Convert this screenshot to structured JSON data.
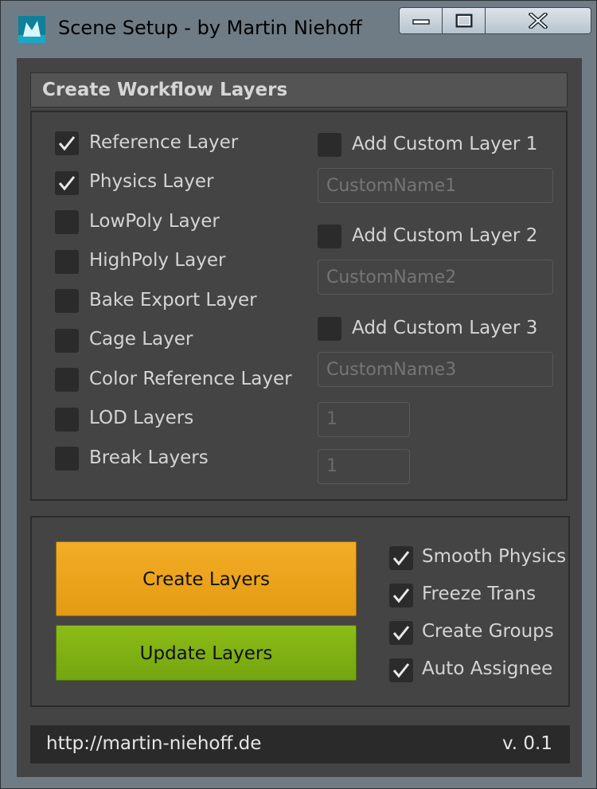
{
  "window": {
    "title": "Scene Setup - by Martin Niehoff"
  },
  "layers_section": {
    "title": "Create Workflow Layers",
    "layers": [
      {
        "label": "Reference Layer",
        "checked": true
      },
      {
        "label": "Physics Layer",
        "checked": true
      },
      {
        "label": "LowPoly Layer",
        "checked": false
      },
      {
        "label": "HighPoly Layer",
        "checked": false
      },
      {
        "label": "Bake Export Layer",
        "checked": false
      },
      {
        "label": "Cage Layer",
        "checked": false
      },
      {
        "label": "Color Reference Layer",
        "checked": false
      },
      {
        "label": "LOD Layers",
        "checked": false
      },
      {
        "label": "Break Layers",
        "checked": false
      }
    ],
    "custom_layers": [
      {
        "label": "Add Custom Layer 1",
        "checked": false,
        "placeholder": "CustomName1"
      },
      {
        "label": "Add Custom Layer 2",
        "checked": false,
        "placeholder": "CustomName2"
      },
      {
        "label": "Add Custom Layer 3",
        "checked": false,
        "placeholder": "CustomName3"
      }
    ],
    "lod_count": "1",
    "break_count": "1"
  },
  "actions": {
    "create_label": "Create Layers",
    "update_label": "Update Layers",
    "options": [
      {
        "label": "Smooth Physics",
        "checked": true
      },
      {
        "label": "Freeze Trans",
        "checked": true
      },
      {
        "label": "Create Groups",
        "checked": true
      },
      {
        "label": "Auto Assignee",
        "checked": true
      }
    ]
  },
  "footer": {
    "url": "http://martin-niehoff.de",
    "version": "v. 0.1"
  },
  "colors": {
    "create_button": "#eba41c",
    "update_button": "#7fb013",
    "panel_bg": "#444444",
    "checkbox_bg": "#2b2b2b"
  }
}
